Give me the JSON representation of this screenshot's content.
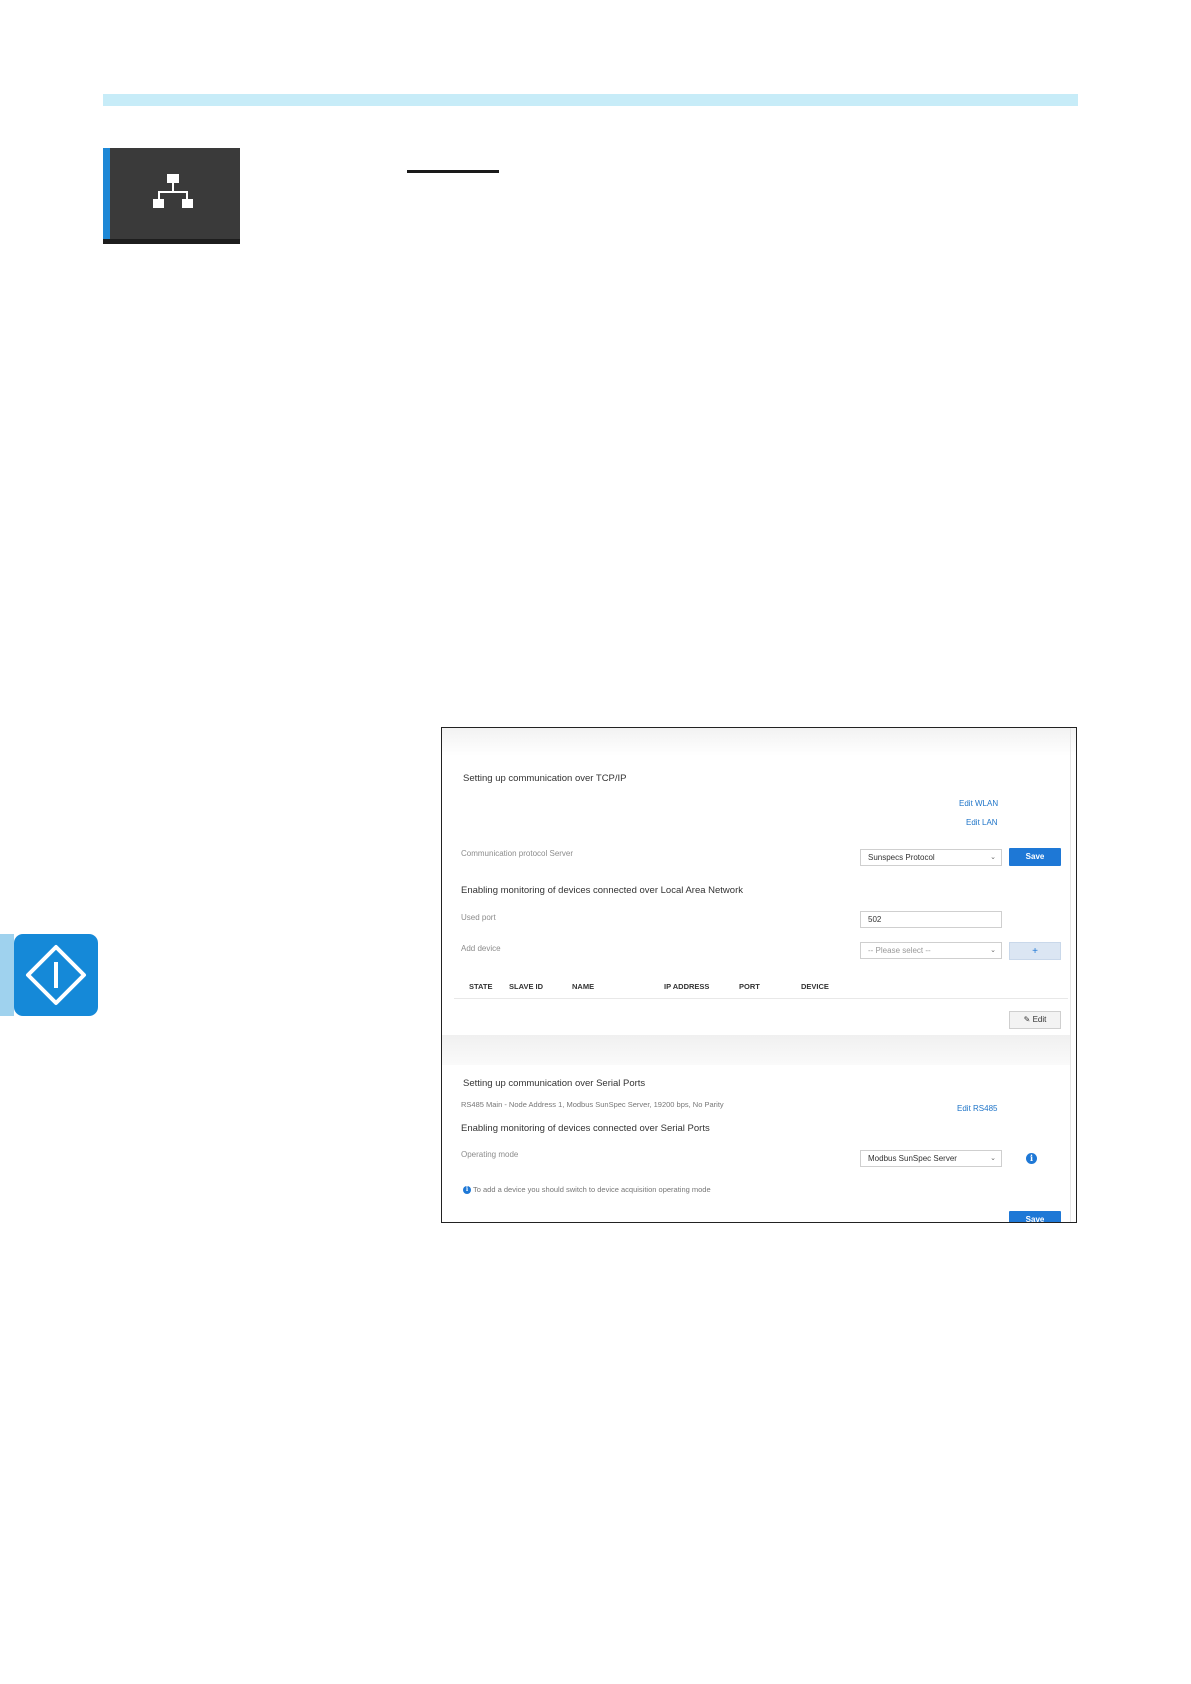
{
  "icons": {
    "menu_tile_icon": "network-icon",
    "side_icon": "important-note-icon"
  },
  "colors": {
    "accent_blue": "#1e78d6",
    "top_rule": "#c7ecf8",
    "menu_tile_bg": "#3a3a3a",
    "side_icon_bg": "#1589d8"
  },
  "screenshot": {
    "tcp_section": {
      "title": "Setting up communication over TCP/IP",
      "edit_wlan": "Edit WLAN",
      "edit_lan": "Edit LAN",
      "protocol_label": "Communication protocol Server",
      "protocol_value": "Sunspecs Protocol",
      "save_label": "Save",
      "lan_monitoring_title": "Enabling monitoring of devices connected over Local Area Network",
      "used_port_label": "Used port",
      "used_port_value": "502",
      "add_device_label": "Add device",
      "add_device_placeholder": "-- Please select --",
      "add_button": "+",
      "table_headers": [
        "STATE",
        "SLAVE ID",
        "NAME",
        "IP ADDRESS",
        "PORT",
        "DEVICE"
      ],
      "edit_label": "Edit"
    },
    "serial_section": {
      "title": "Setting up communication over Serial Ports",
      "port_summary": "RS485 Main - Node Address 1, Modbus SunSpec Server, 19200 bps, No Parity",
      "edit_rs485": "Edit RS485",
      "monitoring_title": "Enabling monitoring of devices connected over Serial Ports",
      "operating_mode_label": "Operating mode",
      "operating_mode_value": "Modbus SunSpec Server",
      "hint": "To add a device you should switch to device acquisition operating mode",
      "save_label": "Save"
    }
  }
}
